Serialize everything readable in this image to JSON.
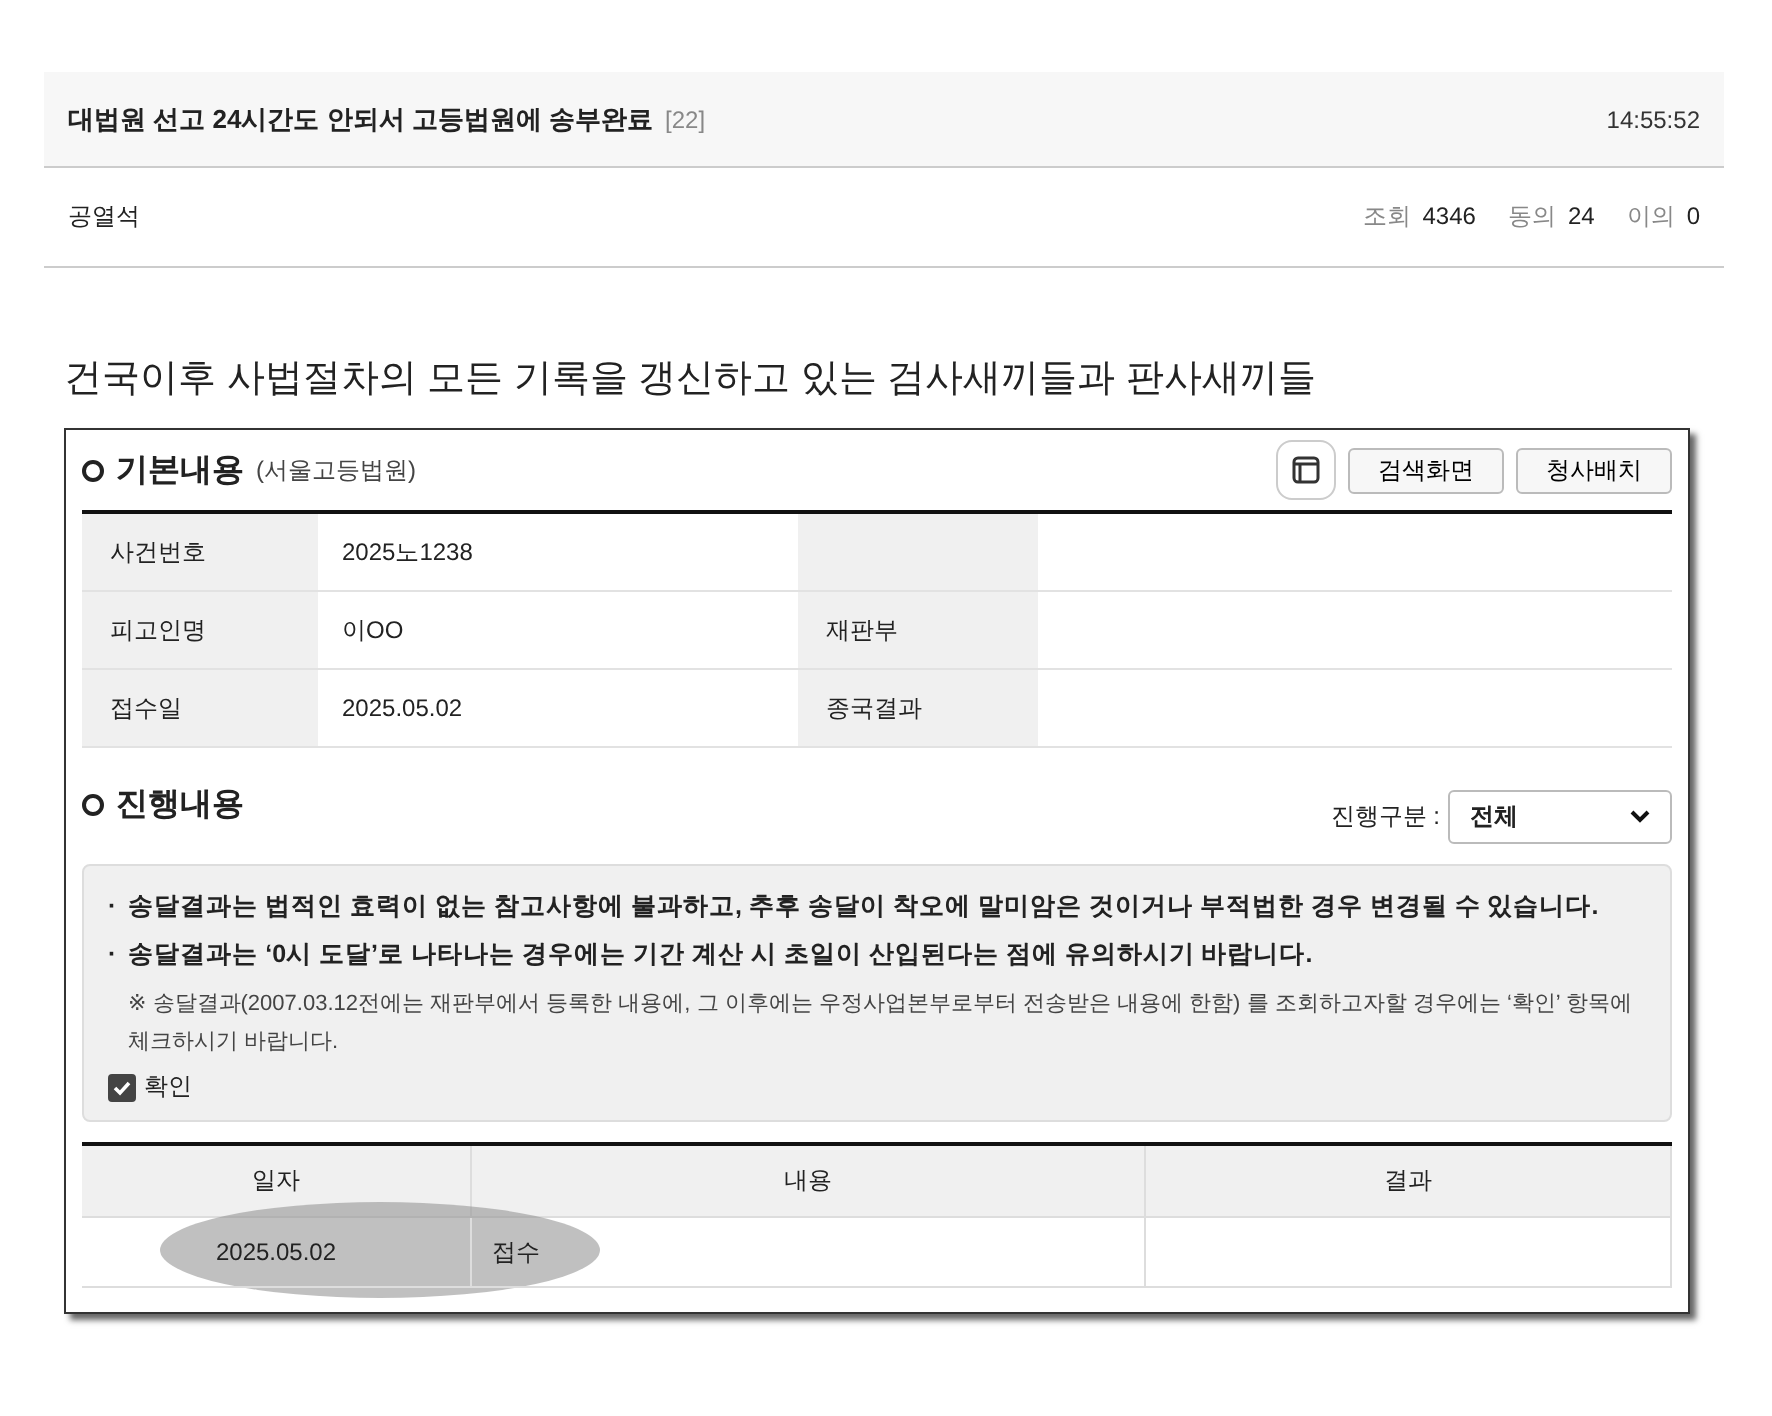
{
  "post": {
    "title": "대법원 선고 24시간도 안되서 고등법원에 송부완료",
    "comment_count": "[22]",
    "time": "14:55:52",
    "author": "공열석",
    "stats": [
      {
        "label": "조회",
        "value": "4346"
      },
      {
        "label": "동의",
        "value": "24"
      },
      {
        "label": "이의",
        "value": "0"
      }
    ]
  },
  "caption": "건국이후 사법절차의 모든 기록을 갱신하고 있는 검사새끼들과 판사새끼들",
  "basic": {
    "title": "기본내용",
    "subtitle": "(서울고등법원)",
    "buttons": [
      "검색화면",
      "청사배치"
    ],
    "rows": [
      {
        "label": "사건번호",
        "value": "2025노1238"
      },
      {
        "label": "피고인명",
        "value": "이OO",
        "label2": "재판부"
      },
      {
        "label": "접수일",
        "value": "2025.05.02",
        "label2": "종국결과"
      }
    ]
  },
  "progress": {
    "title": "진행내용",
    "filter_label": "진행구분 :",
    "filter_value": "전체",
    "notices": [
      {
        "bullet": "·",
        "text": "송달결과는 법적인 효력이 없는 참고사항에 불과하고, 추후 송달이 착오에 말미암은 것이거나 부적법한 경우 변경될 수 있습니다."
      },
      {
        "bullet": "·",
        "text": "송달결과는 ‘0시 도달’로 나타나는 경우에는 기간 계산 시 초일이 산입된다는 점에 유의하시기 바랍니다."
      }
    ],
    "note": "※ 송달결과(2007.03.12전에는 재판부에서 등록한 내용에, 그 이후에는 우정사업본부로부터 전송받은 내용에 한함) 를 조회하고자할 경우에는 ‘확인’ 항목에 체크하시기 바랍니다.",
    "checkbox": {
      "label": "확인",
      "checked": true
    },
    "columns": [
      "일자",
      "내용",
      "결과"
    ],
    "rows": [
      {
        "cells": [
          "2025.05.02",
          "접수"
        ],
        "highlighted": true
      }
    ]
  }
}
